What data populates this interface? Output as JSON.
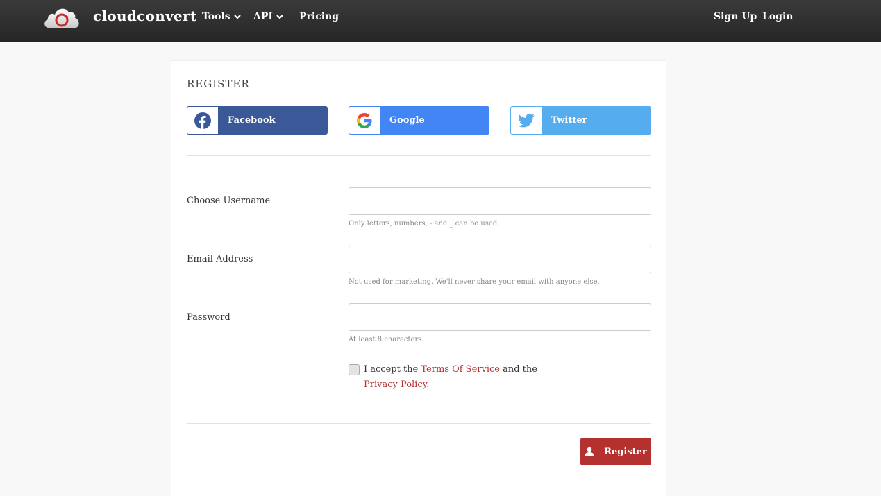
{
  "navbar": {
    "brand": "cloudconvert",
    "logo_icon": "cloud-refresh-icon",
    "items": [
      {
        "label": "Tools",
        "has_dropdown": true
      },
      {
        "label": "API",
        "has_dropdown": true
      },
      {
        "label": "Pricing",
        "has_dropdown": false
      }
    ],
    "right_items": [
      {
        "label": "Sign Up"
      },
      {
        "label": "Login"
      }
    ]
  },
  "form": {
    "title": "REGISTER",
    "social": [
      {
        "label": "Facebook",
        "icon": "facebook-icon",
        "color": "#3b5998"
      },
      {
        "label": "Google",
        "icon": "google-icon",
        "color": "#4285f4"
      },
      {
        "label": "Twitter",
        "icon": "twitter-icon",
        "color": "#55acee"
      }
    ],
    "fields": {
      "username": {
        "label": "Choose Username",
        "value": "",
        "help": "Only letters, numbers, - and _ can be used."
      },
      "email": {
        "label": "Email Address",
        "value": "",
        "help": "Not used for marketing. We'll never share your email with anyone else."
      },
      "password": {
        "label": "Password",
        "value": "",
        "help": "At least 8 characters."
      }
    },
    "tos": {
      "checked": false,
      "text_before": "I accept the ",
      "terms_link": "Terms Of Service",
      "text_middle": " and the ",
      "privacy_link": "Privacy Policy",
      "text_after": "."
    },
    "submit": {
      "label": "Register",
      "icon": "user-icon"
    }
  },
  "colors": {
    "accent": "#b5312f",
    "navbar": "#2d2d2d",
    "background": "#f8f8f8"
  }
}
